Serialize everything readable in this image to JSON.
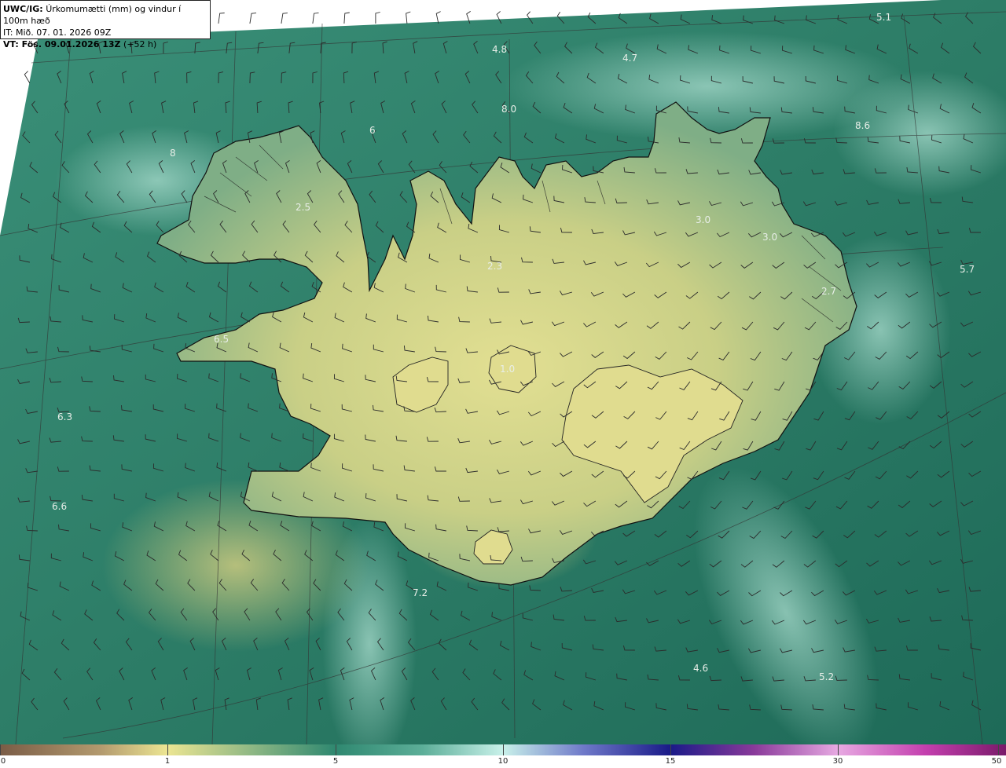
{
  "header": {
    "model": "UWC/IG:",
    "title": "Úrkomumætti (mm) og vindur í 100m hæð",
    "init_time": "IT: Mið. 07. 01. 2026 09Z",
    "valid_prefix": "VT: Fös. 09.01.2026 13Z",
    "valid_suffix": "(+52 h)"
  },
  "colorbar": {
    "ticks": [
      "0",
      "1",
      "5",
      "10",
      "15",
      "30",
      "50"
    ],
    "tick_values": [
      0,
      1,
      5,
      10,
      15,
      30,
      50
    ]
  },
  "map_labels": [
    "5.1",
    "4.8",
    "4.7",
    "8.6",
    "6.5",
    "6.3",
    "6.6",
    "7.2",
    "4.6",
    "5.2",
    "5.7",
    "3.0",
    "3.0",
    "2.7",
    "2.5",
    "2.3",
    "1.0",
    "6",
    "8",
    "8.0"
  ],
  "colors": {
    "sea_dark": "#1f6b58",
    "sea_mid": "#2f8870",
    "sea_light": "#7fc3b3",
    "land_yellow": "#d9d98a",
    "land_green": "#a7b978",
    "coast": "#111111"
  }
}
